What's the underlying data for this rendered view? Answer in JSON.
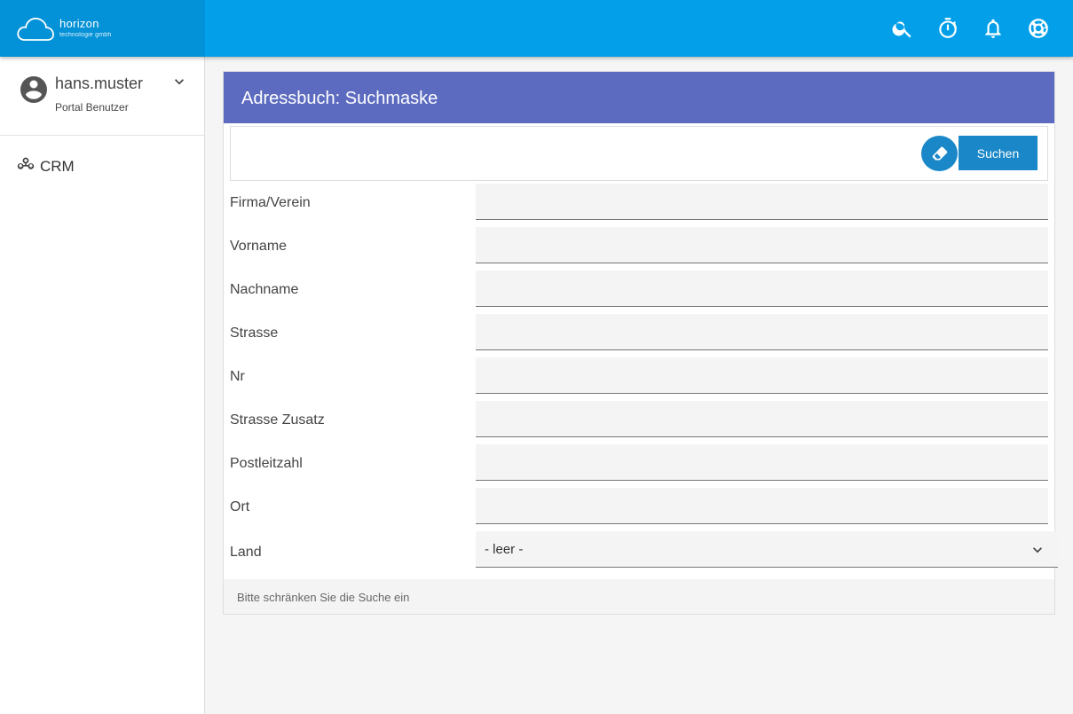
{
  "brand": {
    "name": "horizon",
    "subtitle": "technologie gmbh"
  },
  "topbar": {
    "icons": [
      "search-icon",
      "timer-icon",
      "bell-icon",
      "support-icon"
    ]
  },
  "user": {
    "name": "hans.muster",
    "role": "Portal Benutzer"
  },
  "nav": {
    "items": [
      {
        "label": "CRM",
        "icon": "crm-icon"
      }
    ]
  },
  "panel": {
    "title": "Adressbuch: Suchmaske",
    "search_button": "Suchen",
    "fields": [
      {
        "label": "Firma/Verein",
        "value": ""
      },
      {
        "label": "Vorname",
        "value": ""
      },
      {
        "label": "Nachname",
        "value": ""
      },
      {
        "label": "Strasse",
        "value": ""
      },
      {
        "label": "Nr",
        "value": ""
      },
      {
        "label": "Strasse Zusatz",
        "value": ""
      },
      {
        "label": "Postleitzahl",
        "value": ""
      },
      {
        "label": "Ort",
        "value": ""
      }
    ],
    "land": {
      "label": "Land",
      "selected": "- leer -"
    },
    "footer_text": "Bitte schränken Sie die Suche ein"
  },
  "colors": {
    "topbar": "#03a0e9",
    "brand_bg": "#0391d7",
    "panel_header": "#5c6bc0",
    "button": "#1a87c8"
  }
}
